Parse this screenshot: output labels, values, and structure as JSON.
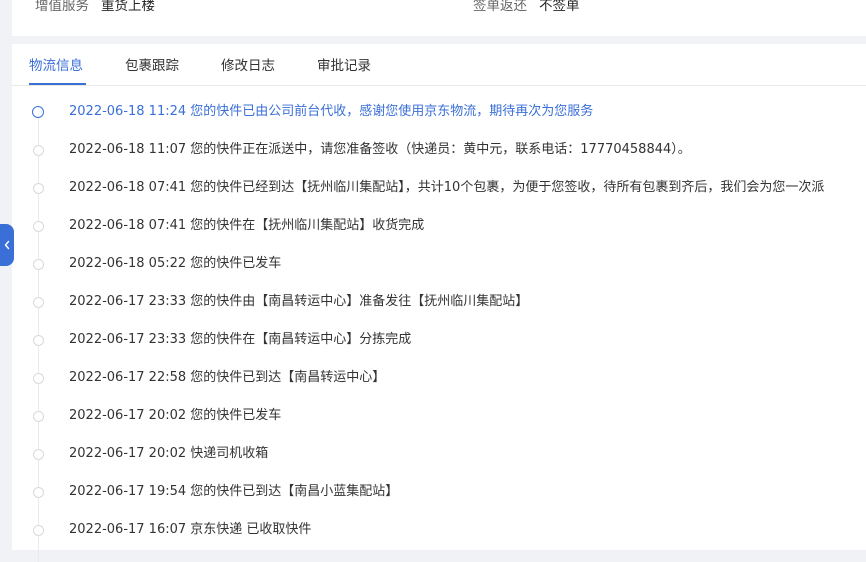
{
  "info_row": {
    "value_added_label": "增值服务",
    "value_added_value": "重货上楼",
    "sign_return_label": "签单返还",
    "sign_return_value": "不签单"
  },
  "tabs": [
    {
      "label": "物流信息",
      "active": true
    },
    {
      "label": "包裹跟踪",
      "active": false
    },
    {
      "label": "修改日志",
      "active": false
    },
    {
      "label": "审批记录",
      "active": false
    }
  ],
  "timeline": [
    {
      "text": "2022-06-18 11:24 您的快件已由公司前台代收，感谢您使用京东物流，期待再次为您服务",
      "active": true
    },
    {
      "text": "2022-06-18 11:07 您的快件正在派送中，请您准备签收（快递员：黄中元，联系电话：17770458844）。",
      "active": false
    },
    {
      "text": "2022-06-18 07:41 您的快件已经到达【抚州临川集配站】，共计10个包裹，为便于您签收，待所有包裹到齐后，我们会为您一次派",
      "active": false
    },
    {
      "text": "2022-06-18 07:41 您的快件在【抚州临川集配站】收货完成",
      "active": false
    },
    {
      "text": "2022-06-18 05:22 您的快件已发车",
      "active": false
    },
    {
      "text": "2022-06-17 23:33 您的快件由【南昌转运中心】准备发往【抚州临川集配站】",
      "active": false
    },
    {
      "text": "2022-06-17 23:33 您的快件在【南昌转运中心】分拣完成",
      "active": false
    },
    {
      "text": "2022-06-17 22:58 您的快件已到达【南昌转运中心】",
      "active": false
    },
    {
      "text": "2022-06-17 20:02 您的快件已发车",
      "active": false
    },
    {
      "text": "2022-06-17 20:02 快递司机收箱",
      "active": false
    },
    {
      "text": "2022-06-17 19:54 您的快件已到达【南昌小蓝集配站】",
      "active": false
    },
    {
      "text": "2022-06-17 16:07 京东快递 已收取快件",
      "active": false
    }
  ],
  "colors": {
    "accent": "#3a6fd8",
    "text": "#333333",
    "muted_dot": "#d9d9d9",
    "background": "#f0f2f5"
  },
  "icons": {
    "collapse": "chevron-left-icon"
  }
}
